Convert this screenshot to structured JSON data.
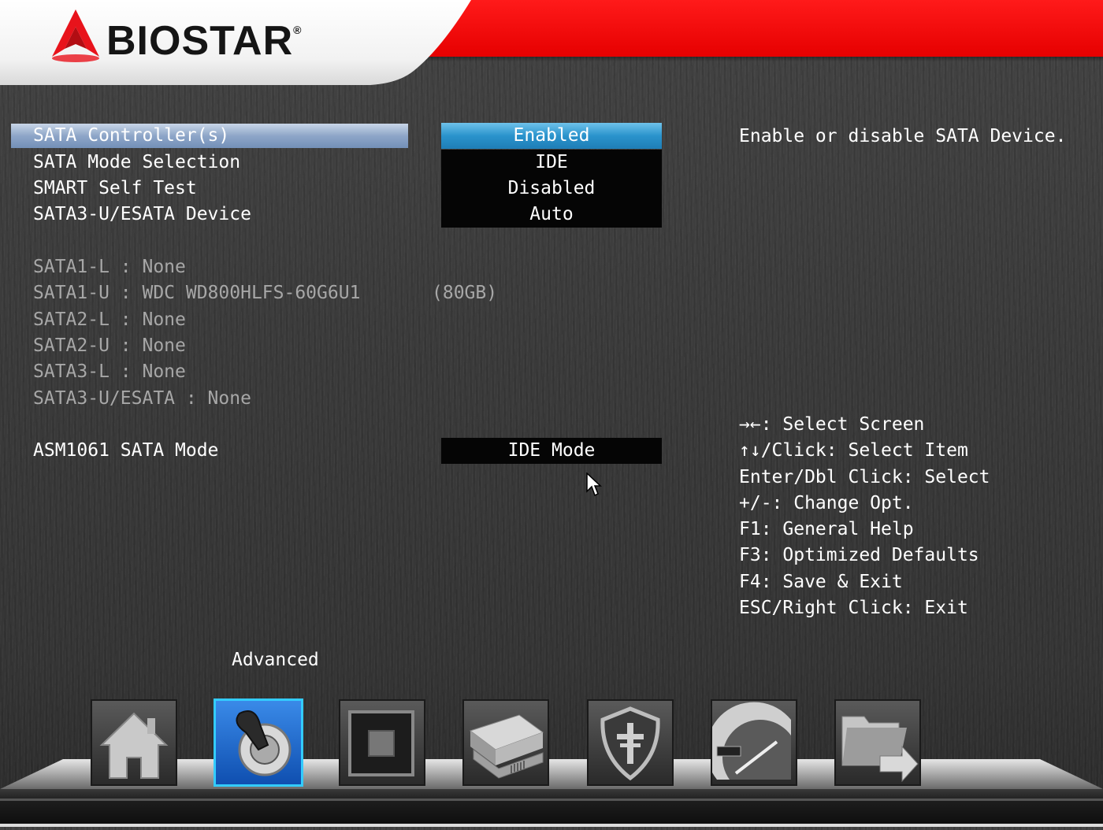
{
  "brand": {
    "name": "BIOSTAR",
    "registered": "®"
  },
  "settings": [
    {
      "label": "SATA Controller(s)",
      "value": "Enabled",
      "selected": true
    },
    {
      "label": "SATA Mode Selection",
      "value": "IDE"
    },
    {
      "label": "SMART Self Test",
      "value": "Disabled"
    },
    {
      "label": "SATA3-U/ESATA Device",
      "value": "Auto"
    }
  ],
  "devices": [
    {
      "label": "SATA1-L : None"
    },
    {
      "label": "SATA1-U : WDC WD800HLFS-60G6U1",
      "size": "(80GB)"
    },
    {
      "label": "SATA2-L : None"
    },
    {
      "label": "SATA2-U : None"
    },
    {
      "label": "SATA3-L : None"
    },
    {
      "label": "SATA3-U/ESATA : None"
    }
  ],
  "asm": {
    "label": "ASM1061 SATA Mode",
    "value": "IDE Mode"
  },
  "help_text": "Enable or disable SATA Device.",
  "keys": [
    "→←: Select Screen",
    "↑↓/Click: Select Item",
    "Enter/Dbl Click: Select",
    "+/-: Change Opt.",
    "F1: General Help",
    "F3: Optimized Defaults",
    "F4: Save & Exit",
    "ESC/Right Click: Exit"
  ],
  "current_tab": "Advanced",
  "tabs": [
    {
      "icon": "home-icon"
    },
    {
      "icon": "advanced-joystick-icon",
      "active": true
    },
    {
      "icon": "chipset-icon"
    },
    {
      "icon": "boot-drive-icon"
    },
    {
      "icon": "security-shield-icon"
    },
    {
      "icon": "overclock-gauge-icon"
    },
    {
      "icon": "save-exit-folder-icon"
    }
  ],
  "colors": {
    "accent_red": "#e60000",
    "selected_value": "#2a93cc",
    "active_tab": "#0f4fb0"
  }
}
